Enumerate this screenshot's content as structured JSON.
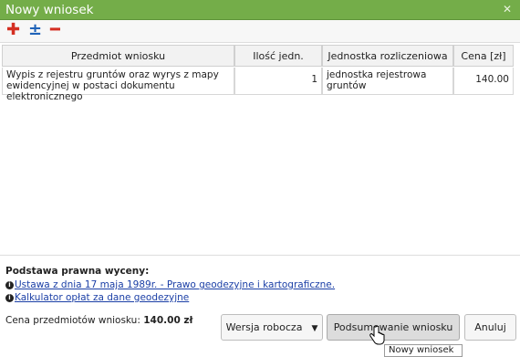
{
  "window": {
    "title": "Nowy wniosek"
  },
  "toolbar": {
    "add_glyph": "✚",
    "edit_glyph": "±",
    "remove_glyph": "━"
  },
  "table": {
    "headers": [
      "Przedmiot wniosku",
      "Ilość jedn.",
      "Jednostka rozliczeniowa",
      "Cena [zł]"
    ],
    "rows": [
      {
        "item": "Wypis z rejestru gruntów oraz wyrys z mapy ewidencyjnej w postaci dokumentu elektronicznego",
        "quantity": "1",
        "unit": "jednostka rejestrowa gruntów",
        "price": "140.00"
      }
    ]
  },
  "legal": {
    "title": "Podstawa prawna wyceny:",
    "links": [
      "Ustawa z dnia 17 maja 1989r. - Prawo geodezyjne i kartograficzne.",
      "Kalkulator opłat za dane geodezyjne"
    ]
  },
  "footer": {
    "total_label": "Cena przedmiotów wniosku:",
    "total_value": "140.00 zł",
    "draft_button": "Wersja robocza",
    "summary_button": "Podsumowanie wniosku",
    "cancel_button": "Anuluj",
    "tooltip": "Nowy wniosek"
  }
}
